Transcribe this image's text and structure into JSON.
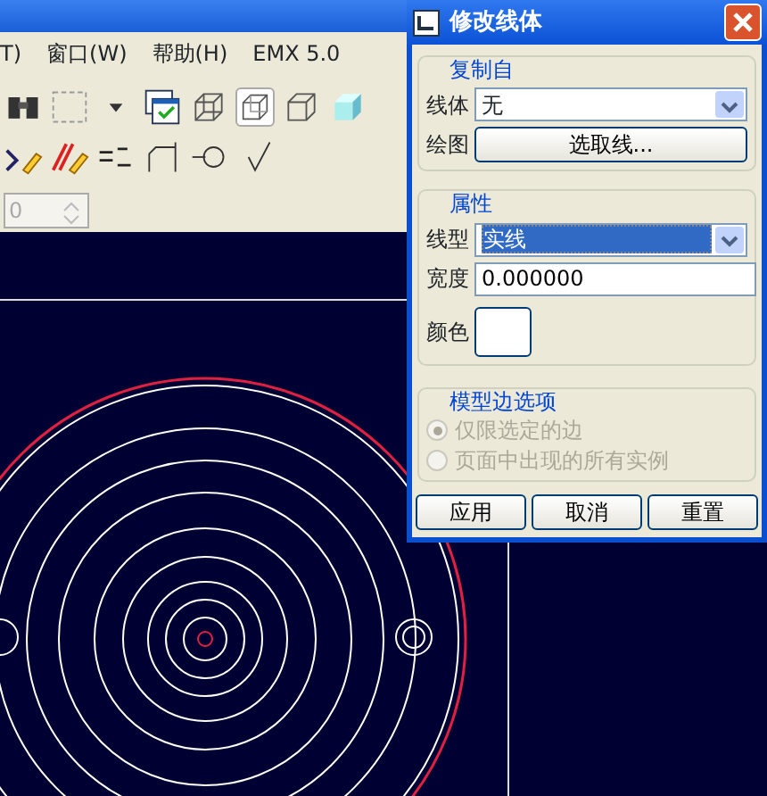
{
  "menu": [
    "T)",
    "窗口(W)",
    "帮助(H)",
    "EMX 5.0"
  ],
  "display_modes": [
    {
      "pressed": false
    },
    {
      "pressed": true
    },
    {
      "pressed": false
    },
    {
      "pressed": false
    }
  ],
  "spinner": {
    "value": "0",
    "disabled": true
  },
  "dialog": {
    "title": "修改线体",
    "copy_from": {
      "title": "复制自",
      "line_style": {
        "label": "线体",
        "value": "无"
      },
      "drawing": {
        "label": "绘图",
        "button": "选取线..."
      }
    },
    "properties": {
      "title": "属性",
      "line_type": {
        "label": "线型",
        "value": "实线",
        "highlighted": true
      },
      "width": {
        "label": "宽度",
        "value": "0.000000"
      },
      "color": {
        "label": "颜色",
        "color": "#ffffff"
      }
    },
    "model_edge_options": {
      "title": "模型边选项",
      "options": [
        {
          "label": "仅限选定的边",
          "selected": true,
          "disabled": true
        },
        {
          "label": "页面中出现的所有实例",
          "selected": false,
          "disabled": true
        }
      ]
    },
    "buttons": [
      "应用",
      "取消",
      "重置"
    ]
  }
}
